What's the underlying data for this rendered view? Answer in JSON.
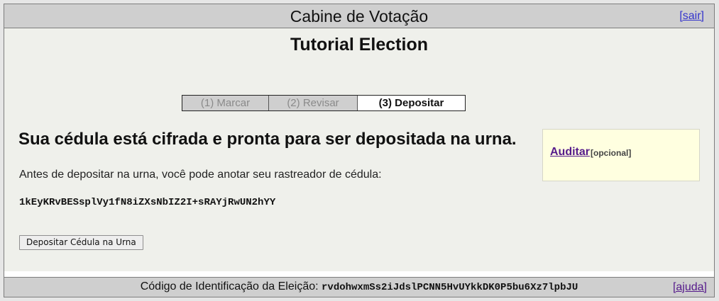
{
  "header": {
    "title": "Cabine de Votação",
    "logout_label": "[sair]"
  },
  "election": {
    "name": "Tutorial Election"
  },
  "steps": [
    {
      "label": "(1) Marcar",
      "state": "done"
    },
    {
      "label": "(2) Revisar",
      "state": "done"
    },
    {
      "label": "(3) Depositar",
      "state": "active"
    }
  ],
  "main": {
    "headline": "Sua cédula está cifrada e pronta para ser depositada na urna.",
    "instruction": "Antes de depositar na urna, você pode anotar seu rastreador de cédula:",
    "tracker": "1kEyKRvBESsplVy1fN8iZXsNbIZ2I+sRAYjRwUN2hYY",
    "cast_button_label": "Depositar Cédula na Urna"
  },
  "audit": {
    "link_label": "Auditar",
    "optional_label": "[opcional]"
  },
  "footer": {
    "code_label": "Código de Identificação da Eleição:",
    "code_value": "rvdohwxmSs2iJdslPCNN5HvUYkkDK0P5bu6Xz7lpbJU",
    "help_label": "[ajuda]"
  },
  "colors": {
    "header_bg": "#cfcfcf",
    "page_bg": "#eff0eb",
    "audit_bg": "#ffffe0",
    "link_blue": "#3333cc",
    "link_visited": "#551a8b"
  }
}
